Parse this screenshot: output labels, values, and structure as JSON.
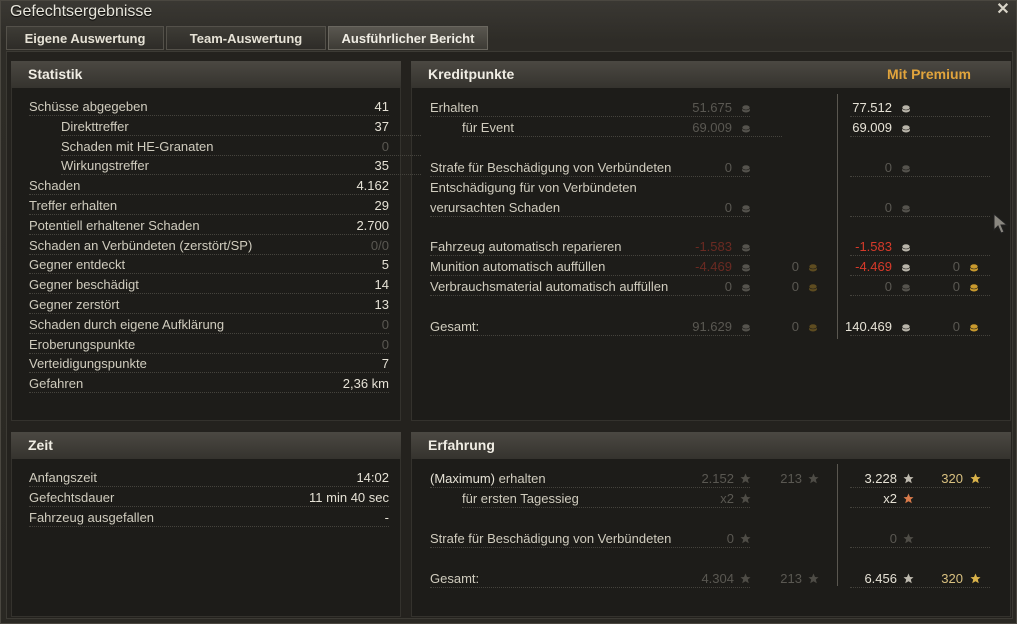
{
  "window": {
    "title": "Gefechtsergebnisse",
    "tabs": [
      "Eigene Auswertung",
      "Team-Auswertung",
      "Ausführlicher Bericht"
    ],
    "active_tab": 2
  },
  "statistik": {
    "header": "Statistik",
    "rows": [
      {
        "label": "Schüsse abgegeben",
        "value": "41"
      },
      {
        "label": "Direkttreffer",
        "value": "37"
      },
      {
        "label": "Schaden mit HE-Granaten",
        "value": "0"
      },
      {
        "label": "Wirkungstreffer",
        "value": "35"
      },
      {
        "label": "Schaden",
        "value": "4.162"
      },
      {
        "label": "Treffer erhalten",
        "value": "29"
      },
      {
        "label": "Potentiell erhaltener Schaden",
        "value": "2.700"
      },
      {
        "label": "Schaden an Verbündeten (zerstört/SP)",
        "value": "0/0"
      },
      {
        "label": "Gegner entdeckt",
        "value": "5"
      },
      {
        "label": "Gegner beschädigt",
        "value": "14"
      },
      {
        "label": "Gegner zerstört",
        "value": "13"
      },
      {
        "label": "Schaden durch eigene Aufklärung",
        "value": "0"
      },
      {
        "label": "Eroberungspunkte",
        "value": "0"
      },
      {
        "label": "Verteidigungspunkte",
        "value": "7"
      },
      {
        "label": "Gefahren",
        "value": "2,36 km"
      }
    ]
  },
  "zeit": {
    "header": "Zeit",
    "rows": [
      {
        "label": "Anfangszeit",
        "value": "14:02"
      },
      {
        "label": "Gefechtsdauer",
        "value": "11 min 40 sec"
      },
      {
        "label": "Fahrzeug ausgefallen",
        "value": "-"
      }
    ]
  },
  "kredit": {
    "header": "Kreditpunkte",
    "premium_label": "Mit Premium",
    "rows": [
      {
        "label": "Erhalten",
        "a": "51.675",
        "b": "",
        "pa": "77.512",
        "pb": ""
      },
      {
        "label": "für Event",
        "a": "69.009",
        "b": "",
        "pa": "69.009",
        "pb": ""
      },
      {
        "label": "Strafe für Beschädigung von Verbündeten",
        "a": "0",
        "b": "",
        "pa": "0",
        "pb": ""
      },
      {
        "label": "Entschädigung für von Verbündeten",
        "a": "",
        "b": "",
        "pa": "",
        "pb": ""
      },
      {
        "label": "verursachten Schaden",
        "a": "0",
        "b": "",
        "pa": "0",
        "pb": ""
      },
      {
        "label": "Fahrzeug automatisch reparieren",
        "a": "-1.583",
        "b": "",
        "pa": "-1.583",
        "pb": ""
      },
      {
        "label": "Munition automatisch auffüllen",
        "a": "-4.469",
        "b": "0",
        "pa": "-4.469",
        "pb": "0"
      },
      {
        "label": "Verbrauchsmaterial automatisch auffüllen",
        "a": "0",
        "b": "0",
        "pa": "0",
        "pb": "0"
      },
      {
        "label": "Gesamt:",
        "a": "91.629",
        "b": "0",
        "pa": "140.469",
        "pb": "0"
      }
    ]
  },
  "erfahrung": {
    "header": "Erfahrung",
    "rows": [
      {
        "label_pre": "(Maximum)",
        "label": " erhalten",
        "a": "2.152",
        "b": "213",
        "pa": "3.228",
        "pb": "320"
      },
      {
        "label_pre": "",
        "label": "für ersten Tagessieg",
        "a": "x2",
        "b": "",
        "pa": "x2",
        "pb": ""
      },
      {
        "label_pre": "",
        "label": "Strafe für Beschädigung von Verbündeten",
        "a": "0",
        "b": "",
        "pa": "0",
        "pb": ""
      },
      {
        "label_pre": "",
        "label": "Gesamt:",
        "a": "4.304",
        "b": "213",
        "pa": "6.456",
        "pb": "320"
      }
    ]
  },
  "icons": {
    "credit": "credit-coin-icon",
    "gold": "gold-coin-icon",
    "xp": "experience-star-icon",
    "free_xp": "free-experience-star-icon",
    "close": "close-icon"
  },
  "colors": {
    "premium": "#e1a43c",
    "negative": "#d63a2a",
    "gold": "#c99a2e"
  }
}
